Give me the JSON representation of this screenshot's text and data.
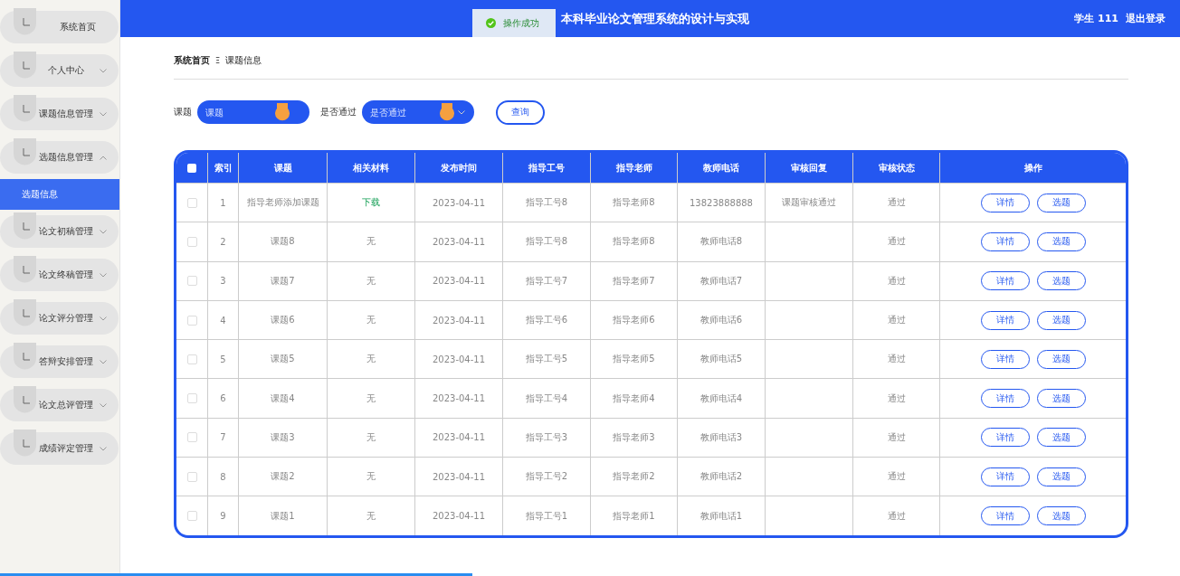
{
  "sidebar": {
    "items": [
      {
        "label": "系统首页",
        "kind": "link"
      },
      {
        "label": "个人中心",
        "kind": "menu",
        "expanded": false
      },
      {
        "label": "课题信息管理",
        "kind": "menu",
        "expanded": false
      },
      {
        "label": "选题信息管理",
        "kind": "menu",
        "expanded": true,
        "children": [
          {
            "label": "选题信息",
            "selected": true
          }
        ]
      },
      {
        "label": "论文初稿管理",
        "kind": "menu",
        "expanded": false
      },
      {
        "label": "论文终稿管理",
        "kind": "menu",
        "expanded": false
      },
      {
        "label": "论文评分管理",
        "kind": "menu",
        "expanded": false
      },
      {
        "label": "答辩安排管理",
        "kind": "menu",
        "expanded": false
      },
      {
        "label": "论文总评管理",
        "kind": "menu",
        "expanded": false
      },
      {
        "label": "成绩评定管理",
        "kind": "menu",
        "expanded": false
      }
    ]
  },
  "header": {
    "title": "本科毕业论文管理系统的设计与实现",
    "user": "学生 111",
    "logout": "退出登录"
  },
  "toast": {
    "message": "操作成功"
  },
  "breadcrumb": [
    "系统首页",
    "课题信息"
  ],
  "breadcrumb_separator": "Ξ",
  "search": {
    "fields": [
      {
        "label": "课题",
        "placeholder": "课题",
        "kind": "input"
      },
      {
        "label": "是否通过",
        "placeholder": "是否通过",
        "kind": "select"
      }
    ],
    "button": "查询"
  },
  "table": {
    "all_checked": false,
    "columns": [
      "索引",
      "课题",
      "相关材料",
      "发布时间",
      "指导工号",
      "指导老师",
      "教师电话",
      "审核回复",
      "审核状态",
      "操作"
    ],
    "rows": [
      {
        "checked": false,
        "cells": [
          "1",
          "指导老师添加课题",
          "下载",
          "2023-04-11",
          "指导工号8",
          "指导老师8",
          "13823888888",
          "课题审核通过",
          "通过"
        ],
        "material_link": true,
        "actions": [
          "详情",
          "选题"
        ]
      },
      {
        "checked": false,
        "cells": [
          "2",
          "课题8",
          "无",
          "2023-04-11",
          "指导工号8",
          "指导老师8",
          "教师电话8",
          "",
          "通过"
        ],
        "material_link": false,
        "actions": [
          "详情",
          "选题"
        ]
      },
      {
        "checked": false,
        "cells": [
          "3",
          "课题7",
          "无",
          "2023-04-11",
          "指导工号7",
          "指导老师7",
          "教师电话7",
          "",
          "通过"
        ],
        "material_link": false,
        "actions": [
          "详情",
          "选题"
        ]
      },
      {
        "checked": false,
        "cells": [
          "4",
          "课题6",
          "无",
          "2023-04-11",
          "指导工号6",
          "指导老师6",
          "教师电话6",
          "",
          "通过"
        ],
        "material_link": false,
        "actions": [
          "详情",
          "选题"
        ]
      },
      {
        "checked": false,
        "cells": [
          "5",
          "课题5",
          "无",
          "2023-04-11",
          "指导工号5",
          "指导老师5",
          "教师电话5",
          "",
          "通过"
        ],
        "material_link": false,
        "actions": [
          "详情",
          "选题"
        ]
      },
      {
        "checked": false,
        "cells": [
          "6",
          "课题4",
          "无",
          "2023-04-11",
          "指导工号4",
          "指导老师4",
          "教师电话4",
          "",
          "通过"
        ],
        "material_link": false,
        "actions": [
          "详情",
          "选题"
        ]
      },
      {
        "checked": false,
        "cells": [
          "7",
          "课题3",
          "无",
          "2023-04-11",
          "指导工号3",
          "指导老师3",
          "教师电话3",
          "",
          "通过"
        ],
        "material_link": false,
        "actions": [
          "详情",
          "选题"
        ]
      },
      {
        "checked": false,
        "cells": [
          "8",
          "课题2",
          "无",
          "2023-04-11",
          "指导工号2",
          "指导老师2",
          "教师电话2",
          "",
          "通过"
        ],
        "material_link": false,
        "actions": [
          "详情",
          "选题"
        ]
      },
      {
        "checked": false,
        "cells": [
          "9",
          "课题1",
          "无",
          "2023-04-11",
          "指导工号1",
          "指导老师1",
          "教师电话1",
          "",
          "通过"
        ],
        "material_link": false,
        "actions": [
          "详情",
          "选题"
        ]
      }
    ]
  },
  "loading_bar": {
    "level": 0.4
  }
}
